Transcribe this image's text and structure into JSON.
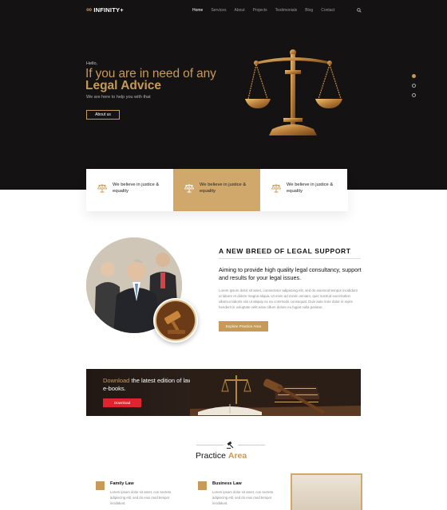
{
  "brand": {
    "name": "INFINITY+",
    "logo_glyph": "∞",
    "accent": "#c79a57"
  },
  "nav": {
    "items": [
      {
        "label": "Home",
        "active": true
      },
      {
        "label": "Services",
        "active": false
      },
      {
        "label": "About",
        "active": false
      },
      {
        "label": "Projects",
        "active": false
      },
      {
        "label": "Testimonials",
        "active": false
      },
      {
        "label": "Blog",
        "active": false
      },
      {
        "label": "Contact",
        "active": false
      }
    ],
    "search_icon": "search-icon"
  },
  "hero": {
    "greeting": "Hello,",
    "headline_line1": "If you are in need of any",
    "headline_line2": "Legal Advice",
    "subtitle": "We are here to help you with that",
    "button_label": "About us",
    "slider_dots": [
      true,
      false,
      false
    ]
  },
  "features": [
    {
      "text": "We believe in justice & equality",
      "active": false,
      "icon": "scales-icon"
    },
    {
      "text": "We believe in justice & equality",
      "active": true,
      "icon": "scales-icon"
    },
    {
      "text": "We believe in justice & equality",
      "active": false,
      "icon": "scales-icon"
    }
  ],
  "about": {
    "title": "A NEW BREED OF LEGAL SUPPORT",
    "lead": "Aiming to provide high quality legal consultancy, support and results for your legal issues.",
    "body": "Lorem ipsum dolor sit amet, consectetur adipiscing elit, sed do eiusmod tempor incididunt ut labore et dolore magna aliqua. Ut enim ad minim veniam, quis nostrud exercitation ullamco laboris nisi ut aliquip ex ea commodo consequat. Duis aute irure dolor in repre henderit in voluptate velit esse cillum dolore eu fugiat nulla pariatur.",
    "button_label": "Explore Practice Area"
  },
  "banner": {
    "highlight": "Download",
    "text": " the latest edition of law e-books.",
    "button_label": "Download",
    "button_color": "#e0242f"
  },
  "practice": {
    "title_plain": "Practice",
    "title_accent": "Area",
    "cards": [
      {
        "title": "Family Law",
        "body": "Lorem ipsum dolor sit amet, con sectetu adipiscing elit, sed do eius mod tempor incididunt."
      },
      {
        "title": "Business Law",
        "body": "Lorem ipsum dolor sit amet, con sectetu adipiscing elit, sed do eius mod tempor incididunt."
      }
    ]
  }
}
